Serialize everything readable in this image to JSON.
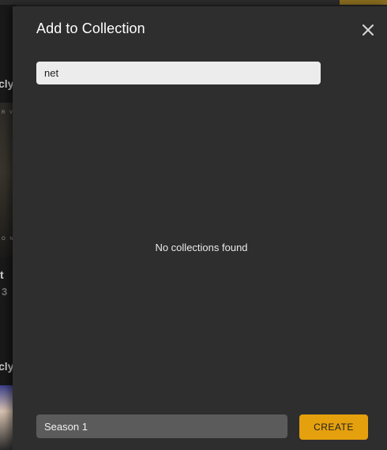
{
  "background": {
    "row1_label": "cly",
    "row2_label": "t",
    "row2_number": "3",
    "row3_label": "cly",
    "poster_caption_top": "R V",
    "poster_caption_bottom": "O N"
  },
  "dialog": {
    "title": "Add to Collection",
    "close_icon": "close-icon",
    "search": {
      "value": "net",
      "placeholder": ""
    },
    "empty_message": "No collections found",
    "new_collection": {
      "value": "Season 1",
      "placeholder": ""
    },
    "create_label": "CREATE"
  },
  "colors": {
    "accent": "#e5a00d",
    "dialog_bg": "#2e2e2e",
    "search_bg": "#ececec",
    "name_input_bg": "#5b5b5b"
  }
}
